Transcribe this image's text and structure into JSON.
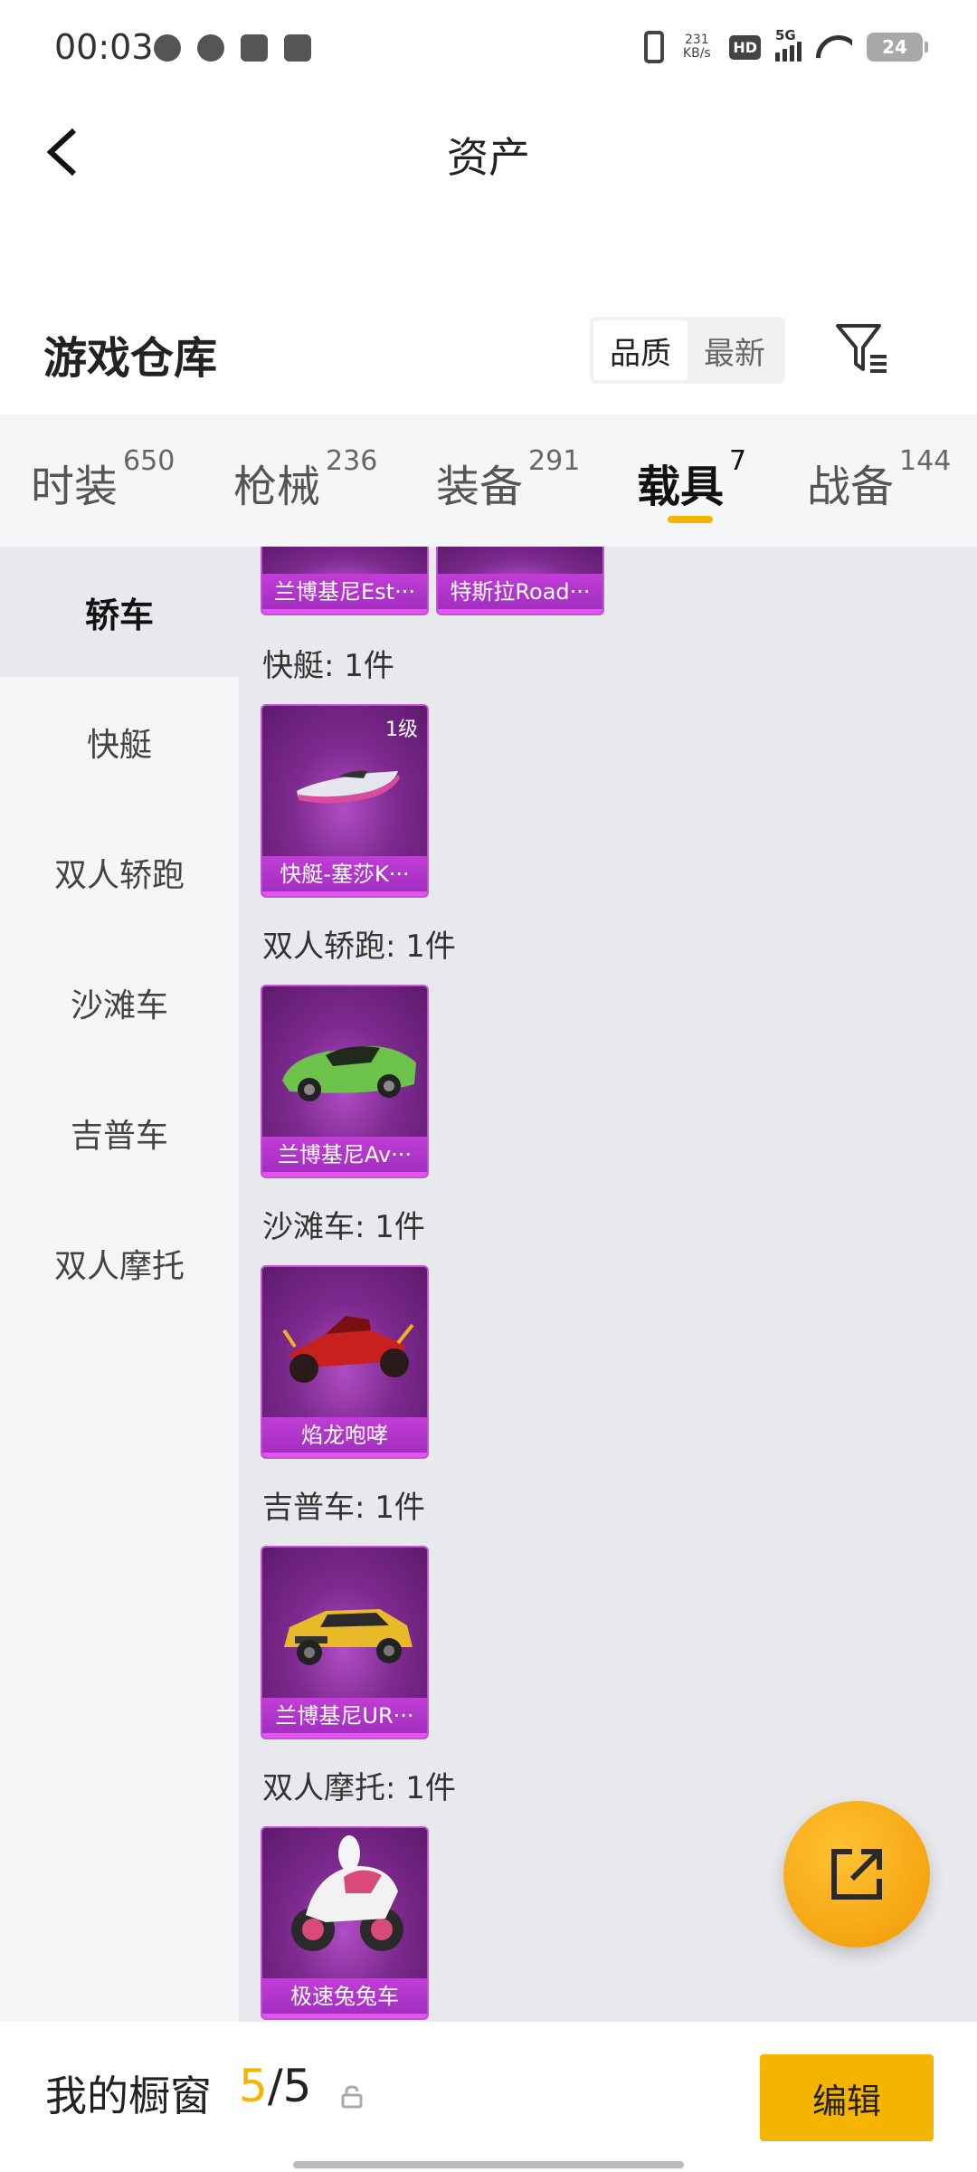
{
  "status_bar": {
    "time": "00:03",
    "net_speed_value": "231",
    "net_speed_unit": "KB/s",
    "hd": "HD",
    "network": "5G",
    "battery": "24",
    "icons": [
      "wechat-icon",
      "leaf-icon",
      "bag-icon",
      "shield-icon",
      "vibrate-icon",
      "signal-icon",
      "wifi-icon",
      "battery-icon"
    ]
  },
  "header": {
    "title": "资产",
    "back_icon": "chevron-left-icon"
  },
  "warehouse": {
    "title": "游戏仓库",
    "sort_options": [
      "品质",
      "最新"
    ],
    "active_sort": "品质",
    "filter_icon": "filter-icon"
  },
  "tabs": [
    {
      "label": "时装",
      "count": "650"
    },
    {
      "label": "枪械",
      "count": "236"
    },
    {
      "label": "装备",
      "count": "291"
    },
    {
      "label": "载具",
      "count": "7",
      "active": true
    },
    {
      "label": "战备",
      "count": "144"
    }
  ],
  "side_nav": [
    {
      "label": "轿车",
      "active": true
    },
    {
      "label": "快艇"
    },
    {
      "label": "双人轿跑"
    },
    {
      "label": "沙滩车"
    },
    {
      "label": "吉普车"
    },
    {
      "label": "双人摩托"
    }
  ],
  "top_cards": [
    {
      "name": "兰博基尼Est···"
    },
    {
      "name": "特斯拉Road···"
    }
  ],
  "sections": [
    {
      "label": "快艇: 1件",
      "items": [
        {
          "name": "快艇-塞莎K···",
          "level": "1级",
          "icon": "speedboat-icon"
        }
      ]
    },
    {
      "label": "双人轿跑: 1件",
      "items": [
        {
          "name": "兰博基尼Av···",
          "icon": "green-sports-car-icon"
        }
      ]
    },
    {
      "label": "沙滩车: 1件",
      "items": [
        {
          "name": "焰龙咆哮",
          "icon": "red-buggy-icon"
        }
      ]
    },
    {
      "label": "吉普车: 1件",
      "items": [
        {
          "name": "兰博基尼UR···",
          "icon": "yellow-suv-icon"
        }
      ]
    },
    {
      "label": "双人摩托: 1件",
      "items": [
        {
          "name": "极速兔兔车",
          "icon": "motorcycle-icon"
        }
      ]
    }
  ],
  "fab": {
    "icon": "share-icon"
  },
  "bottom_bar": {
    "label": "我的橱窗",
    "count_current": "5",
    "count_separator": "/",
    "count_total": "5",
    "lock_icon": "lock-icon",
    "edit_label": "编辑"
  },
  "colors": {
    "accent": "#f5b400",
    "card_purple": "#7d2a8f",
    "card_name_bar": "#b534cc",
    "tab_bg": "#f5f6f8",
    "content_bg": "#e8e9ec"
  }
}
